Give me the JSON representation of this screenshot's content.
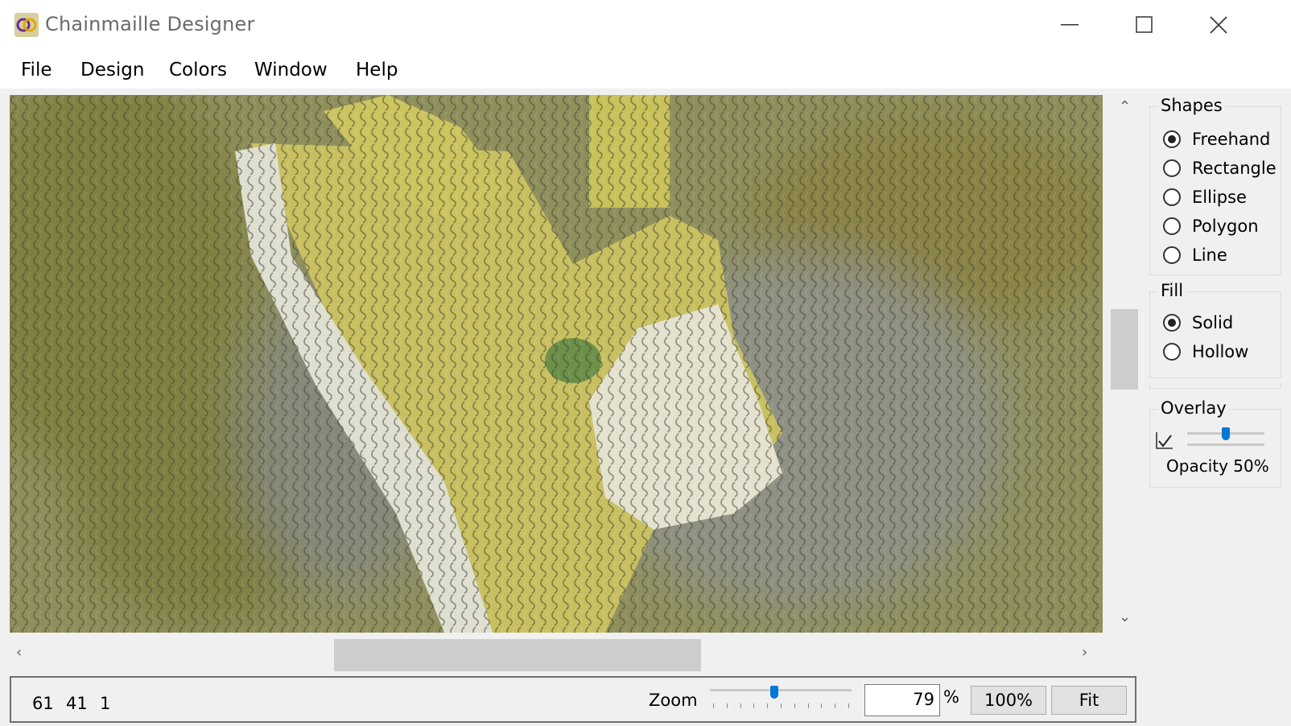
{
  "window": {
    "title": "Chainmaille Designer",
    "icon": "interlocking-rings-icon",
    "controls": [
      "minimize-icon",
      "maximize-icon",
      "close-icon"
    ]
  },
  "menu": {
    "items": [
      {
        "label": "File"
      },
      {
        "label": "Design"
      },
      {
        "label": "Colors"
      },
      {
        "label": "Window"
      },
      {
        "label": "Help"
      }
    ]
  },
  "scroll": {
    "vertical_position": 0.43,
    "horizontal_position": 0.34
  },
  "panel": {
    "shapes": {
      "title": "Shapes",
      "options": [
        {
          "label": "Freehand",
          "checked": true
        },
        {
          "label": "Rectangle",
          "checked": false
        },
        {
          "label": "Ellipse",
          "checked": false
        },
        {
          "label": "Polygon",
          "checked": false
        },
        {
          "label": "Line",
          "checked": false
        }
      ]
    },
    "fill": {
      "title": "Fill",
      "options": [
        {
          "label": "Solid",
          "checked": true
        },
        {
          "label": "Hollow",
          "checked": false
        }
      ]
    },
    "overlay": {
      "title": "Overlay",
      "enabled": true,
      "opacity_label": "Opacity 50%",
      "opacity_value": 0.5
    }
  },
  "status": {
    "coords": [
      "61",
      "41",
      "1"
    ],
    "zoom_label": "Zoom",
    "zoom_value": "79",
    "zoom_unit": "%",
    "zoom_slider": 0.45,
    "btn_100": "100%",
    "btn_fit": "Fit"
  },
  "colors": {
    "olive": "#8f8f55",
    "grey": "#8d8e80",
    "yellow": "#c9c15a",
    "white": "#e2e2d6",
    "green": "#6f8f4a",
    "slider_blue": "#0078d7"
  }
}
